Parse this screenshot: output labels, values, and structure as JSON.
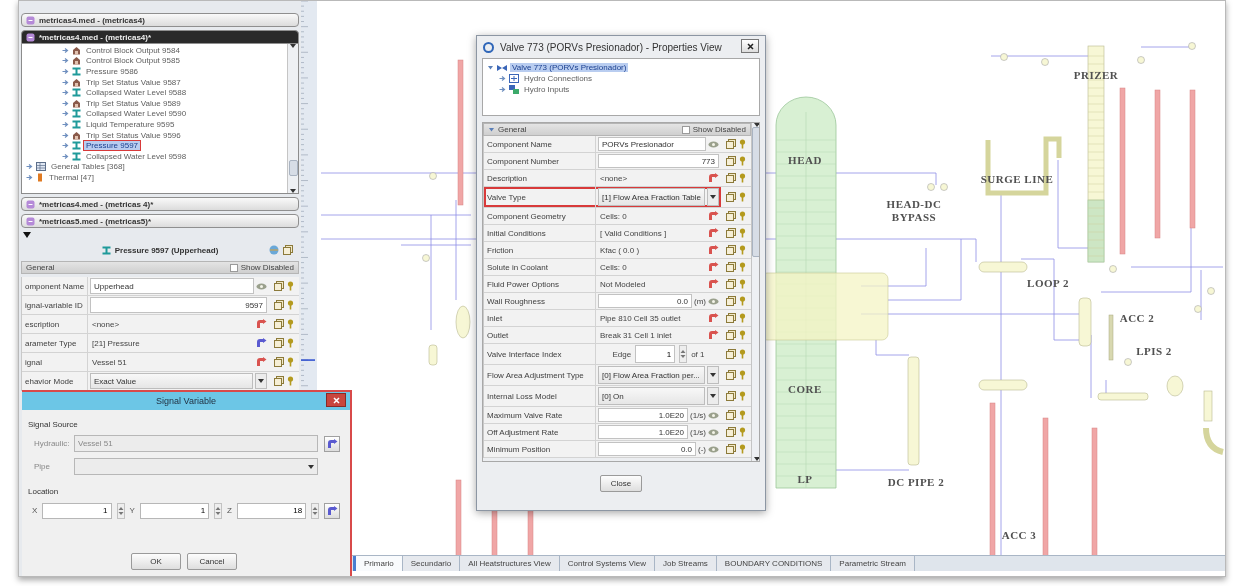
{
  "explorer": {
    "projects": [
      {
        "title": "metricas4.med - (metricas4)",
        "expanded": false
      },
      {
        "title": "*metricas4.med - (metricas4)*",
        "expanded": true,
        "tree": [
          {
            "children": [
              {
                "label": "Control Block Output 9584",
                "kind": "control",
                "expanded": false,
                "selected": false
              },
              {
                "label": "Control Block Output 9585",
                "kind": "control",
                "expanded": false,
                "selected": false
              },
              {
                "label": "Pressure 9586",
                "kind": "signal",
                "expanded": false,
                "selected": false
              },
              {
                "label": "Trip Set Status Value 9587",
                "kind": "control",
                "expanded": false,
                "selected": false
              },
              {
                "label": "Collapsed Water Level 9588",
                "kind": "signal",
                "expanded": false,
                "selected": false
              },
              {
                "label": "Trip Set Status Value 9589",
                "kind": "control",
                "expanded": false,
                "selected": false
              },
              {
                "label": "Collapsed Water Level 9590",
                "kind": "signal",
                "expanded": false,
                "selected": false
              },
              {
                "label": "Liquid Temperature 9595",
                "kind": "signal",
                "expanded": false,
                "selected": false
              },
              {
                "label": "Trip Set Status Value 9596",
                "kind": "control",
                "expanded": false,
                "selected": false
              },
              {
                "label": "Pressure 9597",
                "kind": "signal",
                "expanded": false,
                "selected": true
              },
              {
                "label": "Collapsed Water Level 9598",
                "kind": "signal",
                "expanded": false,
                "selected": false
              }
            ]
          },
          {
            "label": "General Tables [368]",
            "kind": "table",
            "expanded": false,
            "selected": false
          },
          {
            "label": "Thermal [47]",
            "kind": "thermal",
            "expanded": false,
            "selected": false
          }
        ]
      },
      {
        "title": "*metricas4.med - (metricas 4)*",
        "expanded": false
      },
      {
        "title": "*metricas5.med - (metricas5)*",
        "expanded": false
      }
    ]
  },
  "properties_panel": {
    "title": "Pressure 9597 (Upperhead)",
    "section": "General",
    "show_disabled": {
      "label": "Show Disabled",
      "checked": false
    },
    "rows": [
      {
        "label": "omponent Name",
        "kind": "text",
        "value": "Upperhead"
      },
      {
        "label": "ignal-variable ID",
        "kind": "number",
        "value": "9597"
      },
      {
        "label": "escription",
        "kind": "link",
        "value": "<none>",
        "color": "#d9534f"
      },
      {
        "label": "arameter Type",
        "kind": "link",
        "value": "[21] Pressure",
        "color": "#5a5ad0"
      },
      {
        "label": "ignal",
        "kind": "link",
        "value": "Vessel 51",
        "color": "#d9534f"
      },
      {
        "label": "ehavior Mode",
        "kind": "combo",
        "value": "Exact Value"
      }
    ]
  },
  "signal_dialog": {
    "title": "Signal Variable",
    "source_heading": "Signal Source",
    "hydraulic": {
      "label": "Hydraulic:",
      "value": "Vessel 51",
      "disabled": true
    },
    "pipe": {
      "label": "Pipe",
      "disabled": true
    },
    "location_heading": "Location",
    "coords": [
      {
        "label": "X",
        "value": "1"
      },
      {
        "label": "Y",
        "value": "1"
      },
      {
        "label": "Z",
        "value": "18"
      }
    ],
    "buttons": [
      "OK",
      "Cancel"
    ]
  },
  "properties_dialog": {
    "title": "Valve 773 (PORVs Presionador) - Properties View",
    "tree": [
      {
        "label": "Valve 773 (PORVs Presionador)",
        "kind": "valve",
        "expanded": true,
        "selected": true,
        "children": [
          {
            "label": "Hydro Connections",
            "kind": "connections",
            "expanded": false,
            "selected": false
          },
          {
            "label": "Hydro Inputs",
            "kind": "inputs",
            "expanded": false,
            "selected": false
          }
        ]
      }
    ],
    "section": {
      "label": "General",
      "expanded": true
    },
    "show_disabled": {
      "label": "Show Disabled",
      "checked": false
    },
    "rows": [
      {
        "label": "Component Name",
        "kind": "text",
        "value": "PORVs Presionador",
        "outlined": false
      },
      {
        "label": "Component Number",
        "kind": "number",
        "value": "773",
        "outlined": false
      },
      {
        "label": "Description",
        "kind": "link",
        "value": "<none>",
        "color": "#d9534f",
        "outlined": false
      },
      {
        "label": "Valve Type",
        "kind": "combo",
        "value": "[1] Flow Area Fraction Table",
        "outlined": true
      },
      {
        "label": "Component Geometry",
        "kind": "link",
        "value": "Cells: 0",
        "color": "#d9534f",
        "outlined": false
      },
      {
        "label": "Initial Conditions",
        "kind": "link",
        "value": "[ Valid Conditions ]",
        "color": "#d9534f",
        "outlined": false
      },
      {
        "label": "Friction",
        "kind": "link",
        "value": "Kfac ( 0.0 )",
        "color": "#d9534f",
        "outlined": false
      },
      {
        "label": "Solute in Coolant",
        "kind": "link",
        "value": "Cells: 0",
        "color": "#d9534f",
        "outlined": false
      },
      {
        "label": "Fluid Power Options",
        "kind": "link",
        "value": "Not Modeled",
        "color": "#d9534f",
        "outlined": false
      },
      {
        "label": "Wall Roughness",
        "kind": "number",
        "value": "0.0",
        "unit": "(m)",
        "outlined": false
      },
      {
        "label": "Inlet",
        "kind": "link",
        "value": "Pipe 810 Cell 35 outlet",
        "color": "#d9534f",
        "outlined": false
      },
      {
        "label": "Outlet",
        "kind": "link",
        "value": "Break 31 Cell 1 inlet",
        "color": "#d9534f",
        "outlined": false
      },
      {
        "label": "Valve Interface Index",
        "kind": "spinner",
        "prefix": "Edge",
        "value": "1",
        "suffix": "of 1",
        "outlined": false
      },
      {
        "label": "Flow Area Adjustment Type",
        "kind": "combo",
        "value": "[0] Flow Area Fraction per...",
        "outlined": false
      },
      {
        "label": "Internal Loss Model",
        "kind": "combo",
        "value": "[0] On",
        "outlined": false
      },
      {
        "label": "Maximum Valve Rate",
        "kind": "number",
        "value": "1.0E20",
        "unit": "(1/s)",
        "outlined": false
      },
      {
        "label": "Off Adjustment Rate",
        "kind": "number",
        "value": "1.0E20",
        "unit": "(1/s)",
        "outlined": false
      },
      {
        "label": "Minimum Position",
        "kind": "number",
        "value": "0.0",
        "unit": "(-)",
        "outlined": false
      }
    ],
    "button": "Close"
  },
  "diagram": {
    "labels": [
      "HEAD",
      "CORE",
      "LP",
      "HEAD-DC BYPASS",
      "DC PIPE 2",
      "SURGE LINE",
      "ACC 3",
      "PRIZER",
      "LOOP 2",
      "ACC 2",
      "LPIS 2"
    ]
  },
  "view_tabs": [
    {
      "label": "Primario",
      "selected": true
    },
    {
      "label": "Secundario",
      "selected": false
    },
    {
      "label": "All Heatstructures View",
      "selected": false
    },
    {
      "label": "Control Systems View",
      "selected": false
    },
    {
      "label": "Job Streams",
      "selected": false
    },
    {
      "label": "BOUNDARY CONDITIONS",
      "selected": false
    },
    {
      "label": "Parametric Stream",
      "selected": false
    }
  ]
}
